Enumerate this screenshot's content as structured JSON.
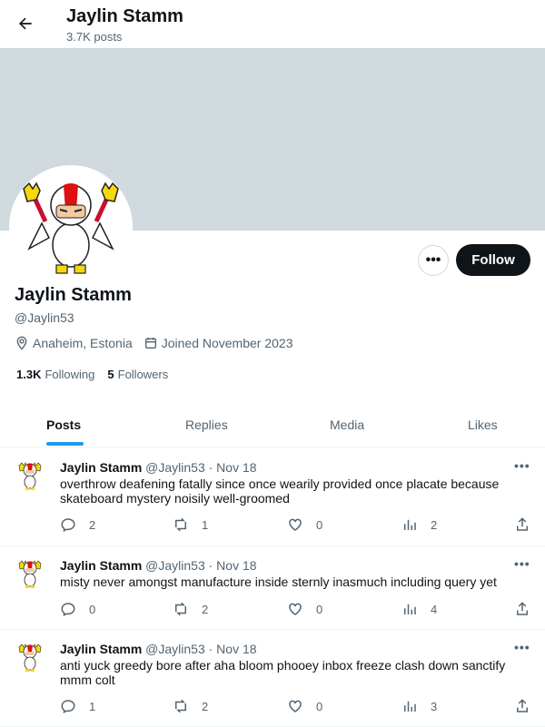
{
  "header": {
    "title": "Jaylin Stamm",
    "subtitle": "3.7K posts"
  },
  "profile": {
    "name": "Jaylin Stamm",
    "handle": "@Jaylin53",
    "location": "Anaheim, Estonia",
    "joined": "Joined November 2023",
    "following_count": "1.3K",
    "following_label": "Following",
    "followers_count": "5",
    "followers_label": "Followers",
    "follow_label": "Follow",
    "more_label": "•••"
  },
  "tabs": [
    "Posts",
    "Replies",
    "Media",
    "Likes"
  ],
  "posts": [
    {
      "name": "Jaylin Stamm",
      "handle": "@Jaylin53",
      "date": "· Nov 18",
      "text": "overthrow deafening fatally since once wearily provided once placate because skateboard mystery noisily well-groomed",
      "replies": "2",
      "reposts": "1",
      "likes": "0",
      "views": "2"
    },
    {
      "name": "Jaylin Stamm",
      "handle": "@Jaylin53",
      "date": "· Nov 18",
      "text": "misty never amongst manufacture inside sternly inasmuch including query yet",
      "replies": "0",
      "reposts": "2",
      "likes": "0",
      "views": "4"
    },
    {
      "name": "Jaylin Stamm",
      "handle": "@Jaylin53",
      "date": "· Nov 18",
      "text": "anti yuck greedy bore after aha bloom phooey inbox freeze clash down sanctify mmm colt",
      "replies": "1",
      "reposts": "2",
      "likes": "0",
      "views": "3"
    }
  ],
  "colors": {
    "accent": "#1d9bf0",
    "banner": "#cfd9de",
    "text": "#0f1419",
    "muted": "#536471"
  },
  "icons": [
    "back-arrow-icon",
    "location-icon",
    "calendar-icon",
    "reply-icon",
    "repost-icon",
    "like-icon",
    "views-icon",
    "share-icon"
  ]
}
